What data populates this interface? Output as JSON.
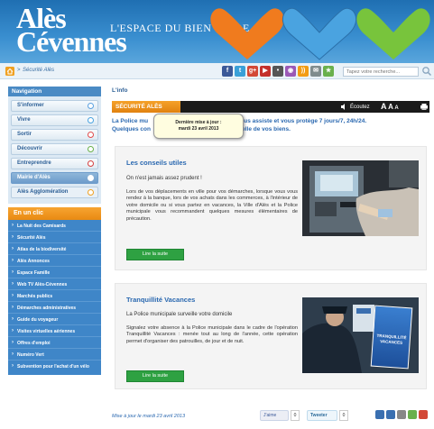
{
  "header": {
    "brand_line1": "Alès",
    "brand_line2": "Cévennes",
    "tagline": "L'ESPACE DU BIEN VIVRE",
    "heart_colors": [
      "#f07b1e",
      "#4aa3e0",
      "#78c43c"
    ]
  },
  "toolbar": {
    "home_icon": "home-icon",
    "breadcrumb_sep": ">",
    "breadcrumb": "Sécurité Alès",
    "social_icons": [
      {
        "name": "facebook-icon",
        "glyph": "f",
        "color": "#3b5998"
      },
      {
        "name": "twitter-icon",
        "glyph": "t",
        "color": "#3aa0d8"
      },
      {
        "name": "googleplus-icon",
        "glyph": "g+",
        "color": "#d34836"
      },
      {
        "name": "youtube-icon",
        "glyph": "▶",
        "color": "#c4302b"
      },
      {
        "name": "flickr-icon",
        "glyph": "•",
        "color": "#555555"
      },
      {
        "name": "picasa-icon",
        "glyph": "◉",
        "color": "#9b59b6"
      },
      {
        "name": "rss-icon",
        "glyph": "))",
        "color": "#f39c12"
      },
      {
        "name": "mail-icon",
        "glyph": "✉",
        "color": "#7f8c8d"
      },
      {
        "name": "favorite-icon",
        "glyph": "★",
        "color": "#6ab04c"
      }
    ],
    "search_placeholder": "Tapez votre recherche..."
  },
  "sidebar": {
    "title": "Navigation",
    "items": [
      {
        "label": "S'informer",
        "dot": "#5aa0e0"
      },
      {
        "label": "Vivre",
        "dot": "#4aa3e0"
      },
      {
        "label": "Sortir",
        "dot": "#e14b4b"
      },
      {
        "label": "Découvrir",
        "dot": "#6ab04c"
      },
      {
        "label": "Entreprendre",
        "dot": "#d43f3f"
      },
      {
        "label": "Mairie d'Alès",
        "dot": "#ffffff"
      },
      {
        "label": "Alès Agglomération",
        "dot": "#f0a020"
      }
    ],
    "clic_title": "En un clic",
    "clic_items": [
      "La Nuit des Camisards",
      "Sécurité Alès",
      "Atlas de la biodiversité",
      "Alès Annonces",
      "Espace Famille",
      "Web TV Alès-Cévennes",
      "Marchés publics",
      "Démarches administratives",
      "Guide du voyageur",
      "Visites virtuelles aériennes",
      "Offres d'emploi",
      "Numéro Vert",
      "Subvention pour l'achat d'un vélo"
    ]
  },
  "main": {
    "label": "L'info",
    "section_title": "SÉCURITÉ ALÈS",
    "listen_label": "Écoutez",
    "text_sizes": [
      "A",
      "A",
      "A"
    ],
    "intro_line1": "La Police mu                                  , vous aide, vous assiste et vous protège 7 jours/7, 24h/24.",
    "intro_line2": "Quelques con                                   sécurité et celle de vos biens.",
    "tooltip_line1": "Dernière mise à jour :",
    "tooltip_line2": "mardi 23 avril 2013",
    "cards": [
      {
        "title": "Les conseils utiles",
        "lead": "On n'est jamais assez prudent !",
        "body": "Lors de vos déplacements en ville pour vos démarches, lorsque vous vous rendez à la banque, lors de vos achats dans les commerces, à l'intérieur de votre domicile ou si vous partez en vacances, la Ville d'Alès et la Police municipale vous recommandent quelques mesures élémentaires de précaution.",
        "button": "Lire la suite"
      },
      {
        "title": "Tranquillité Vacances",
        "lead": "La Police municipale surveille votre domicile",
        "body": "Signalez votre absence à la Police municipale dans le cadre de l'opération Tranquillité Vacances : menée tout au long de l'année, cette opération permet d'organiser des patrouilles, de jour et de nuit.",
        "button": "Lire la suite",
        "poster_text": "TRANQUILLITÉ VACANCES"
      }
    ]
  },
  "footer": {
    "updated": "Mise à jour le mardi 23 avril 2013",
    "like_label": "J'aime",
    "like_count": "0",
    "tweet_label": "Tweeter",
    "tweet_count": "0",
    "share_colors": [
      "#3a6fb0",
      "#3a6fb0",
      "#888888",
      "#6ab04c",
      "#d34836"
    ]
  }
}
